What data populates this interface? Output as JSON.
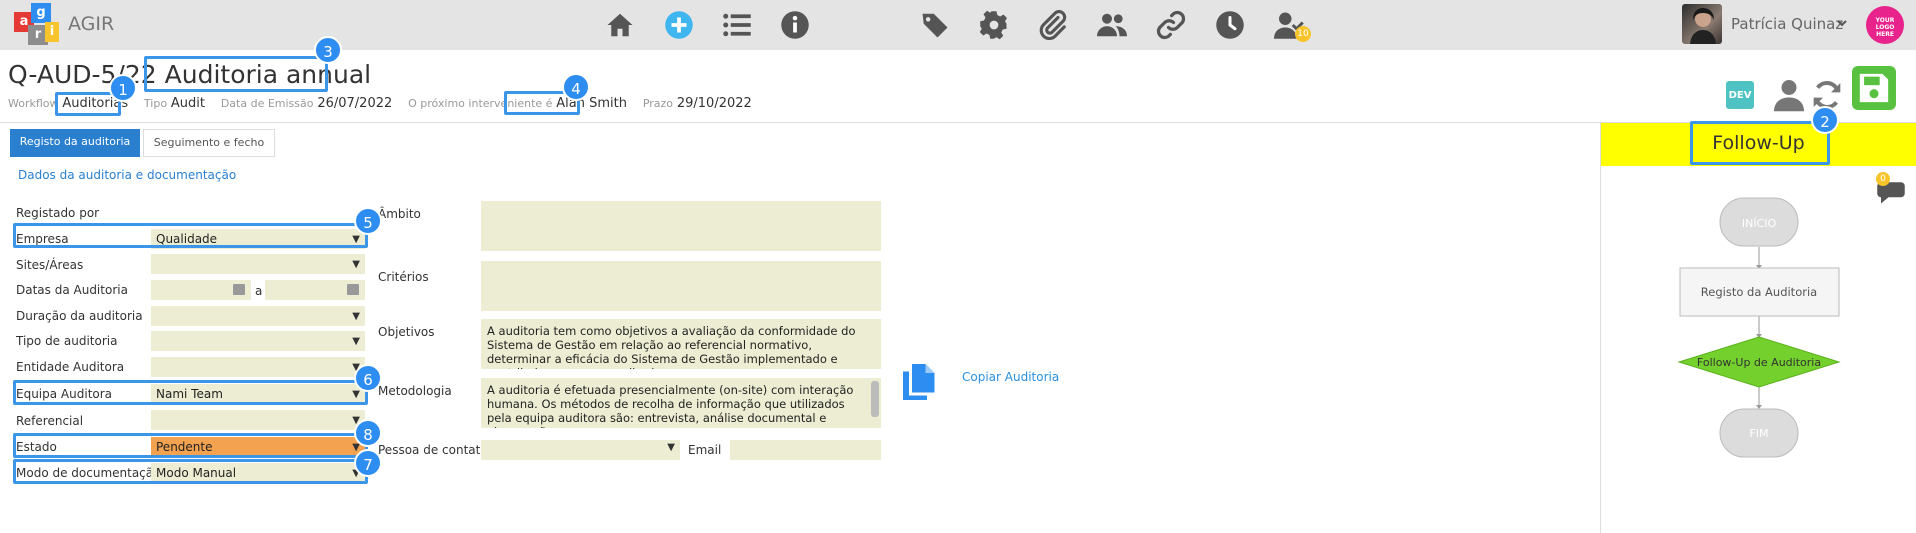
{
  "app": {
    "name": "AGIR",
    "brand_letters": [
      "a",
      "g",
      "r",
      "i"
    ],
    "brand_colors": [
      "#e53935",
      "#2d8df0",
      "#43a047",
      "#f7c52b"
    ]
  },
  "nav": {
    "icons": [
      "home-icon",
      "add-icon",
      "list-icon",
      "info-icon",
      "tag-icon",
      "gear-icon",
      "paperclip-icon",
      "users-icon",
      "link-icon",
      "clock-icon",
      "user-check-icon"
    ],
    "tasks_badge": "10"
  },
  "user": {
    "name": "Patrícia Quinaz",
    "logo_text": "YOUR LOGO HERE"
  },
  "header": {
    "code": "Q-AUD-5/22",
    "title": "Auditoria annual",
    "workflow_label": "Workflow",
    "workflow_value": "Auditorias",
    "type_label": "Tipo",
    "type_value": "Audit",
    "issue_label": "Data de Emissão",
    "issue_value": "26/07/2022",
    "next_label": "O próximo interveniente é",
    "next_value": "Alan Smith",
    "due_label": "Prazo",
    "due_value": "29/10/2022",
    "dev_label": "DEV"
  },
  "tabs": [
    {
      "label": "Registo da auditoria"
    },
    {
      "label": "Seguimento e fecho"
    }
  ],
  "section_title": "Dados da auditoria e documentação",
  "form": {
    "registered_by": "Registado por",
    "date_separator": "a",
    "fields": [
      {
        "label": "Empresa",
        "value": "Qualidade"
      },
      {
        "label": "Sites/Áreas",
        "value": ""
      },
      {
        "label": "Datas da Auditoria",
        "value": ""
      },
      {
        "label": "Duração da auditoria",
        "value": ""
      },
      {
        "label": "Tipo de auditoria",
        "value": ""
      },
      {
        "label": "Entidade Auditora",
        "value": ""
      },
      {
        "label": "Equipa Auditora",
        "value": "Nami Team"
      },
      {
        "label": "Referencial",
        "value": ""
      },
      {
        "label": "Estado",
        "value": "Pendente"
      },
      {
        "label": "Modo de documentação",
        "value": "Modo Manual"
      }
    ],
    "status_color": "#f3a24f"
  },
  "right_form": {
    "ambito_label": "Âmbito",
    "ambito_value": "",
    "criterios_label": "Critérios",
    "criterios_value": "",
    "objetivos_label": "Objetivos",
    "objetivos_value": "A auditoria tem como objetivos a avaliação da conformidade do Sistema de Gestão em relação ao referencial normativo, determinar a eficácia do Sistema de Gestão implementado e contribuir para a sua melhoria.",
    "metodologia_label": "Metodologia",
    "metodologia_value": "A auditoria é efetuada presencialmente (on-site) com interação humana. Os métodos de recolha de informação que  utilizados pela equipa auditora são: entrevista, análise documental e observação ou",
    "contact_label": "Pessoa de contato",
    "email_label": "Email",
    "email_value": ""
  },
  "copy_label": "Copiar Auditoria",
  "followup": {
    "title": "Follow-Up",
    "chat_badge": "0",
    "bar_color": "#ffff00",
    "steps": [
      "INÍCIO",
      "Registo da Auditoria",
      "Follow-Up de Auditoria",
      "FIM"
    ]
  },
  "callouts": [
    "1",
    "2",
    "3",
    "4",
    "5",
    "6",
    "7",
    "8"
  ]
}
